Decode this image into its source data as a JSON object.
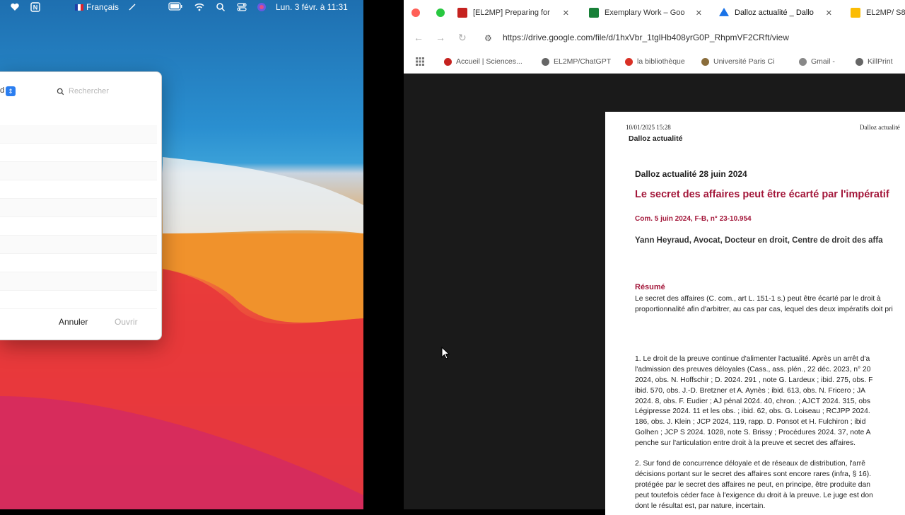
{
  "menubar": {
    "language": "Français",
    "datetime": "Lun. 3 févr. à  11:31"
  },
  "dialog": {
    "search_placeholder": "Rechercher",
    "cancel_label": "Annuler",
    "open_label": "Ouvrir",
    "selector_text": "d"
  },
  "browser": {
    "tabs": [
      {
        "title": "[EL2MP] Preparing for",
        "favicon_color": "#c5221f"
      },
      {
        "title": "Exemplary Work – Goo",
        "favicon_color": "#188038"
      },
      {
        "title": "Dalloz actualité _ Dallo",
        "favicon_color": "#1a73e8"
      },
      {
        "title": "EL2MP/ S8",
        "favicon_color": "#fbbc04"
      }
    ],
    "url": "https://drive.google.com/file/d/1hxVbr_1tglHb408yrG0P_RhpmVF2CRft/view",
    "bookmarks": [
      {
        "label": "Accueil | Sciences...",
        "color": "#c5221f"
      },
      {
        "label": "EL2MP/ChatGPT",
        "color": "#666666"
      },
      {
        "label": "la bibliothèque",
        "color": "#d93025"
      },
      {
        "label": "Université Paris Ci",
        "color": "#8a6d3b"
      },
      {
        "label": "Gmail -",
        "color": "#888888"
      },
      {
        "label": "KillPrint",
        "color": "#666666"
      }
    ]
  },
  "document": {
    "print_date": "10/01/2025 15:28",
    "print_source": "Dalloz actualité",
    "header": "Dalloz actualité",
    "issue": "Dalloz actualité 28 juin 2024",
    "title": "Le secret des affaires peut être écarté par l'impératif",
    "reference": "Com. 5 juin 2024, F-B, n° 23-10.954",
    "author": "Yann Heyraud, Avocat, Docteur en droit, Centre de droit des affa",
    "resume_heading": "Résumé",
    "resume_lines": [
      "Le secret des affaires (C. com., art L. 151-1 s.) peut être écarté par le droit à",
      "proportionnalité afin d'arbitrer, au cas par cas, lequel des deux impératifs doit pri"
    ],
    "para1_lines": [
      "1. Le droit de la preuve continue d'alimenter l'actualité. Après un arrêt d'a",
      "l'admission des preuves déloyales (Cass., ass. plén., 22 déc. 2023, n° 20",
      "2024, obs. N. Hoffschir ; D. 2024. 291 , note G. Lardeux ; ibid. 275, obs. F",
      "ibid. 570, obs. J.-D. Bretzner et A. Aynès ; ibid. 613, obs. N. Fricero ; JA",
      "2024. 8, obs. F. Eudier ; AJ pénal 2024. 40, chron. ; AJCT 2024. 315, obs",
      "Légipresse 2024. 11 et les obs. ; ibid. 62, obs. G. Loiseau ; RCJPP 2024.",
      "186, obs. J. Klein ; JCP 2024, 119, rapp. D. Ponsot et H. Fulchiron ; ibid",
      "Golhen ; JCP S 2024. 1028, note S. Brissy ; Procédures 2024. 37, note A",
      "penche sur l'articulation entre droit à la preuve et secret des affaires."
    ],
    "para2_lines": [
      "2. Sur fond de concurrence déloyale et de réseaux de distribution, l'arrê",
      "décisions portant sur le secret des affaires sont encore rares (infra, § 16).",
      "protégée par le secret des affaires ne peut, en principe, être produite dan",
      "peut toutefois céder face à l'exigence du droit à la preuve. Le juge est don",
      "dont le résultat est, par nature, incertain."
    ]
  }
}
